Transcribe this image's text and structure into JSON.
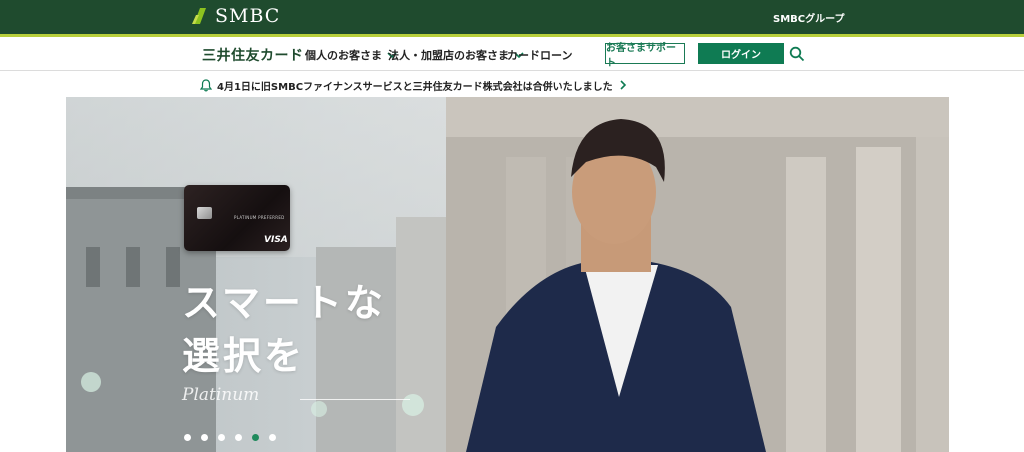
{
  "header": {
    "logo_text": "SMBC",
    "group_link": "SMBCグループ"
  },
  "nav": {
    "brand": "三井住友カード",
    "items": [
      {
        "label": "個人のお客さま",
        "has_dropdown": true
      },
      {
        "label": "法人・加盟店のお客さま",
        "has_dropdown": true
      },
      {
        "label": "カードローン",
        "has_dropdown": false
      }
    ],
    "support_button": "お客さまサポート",
    "login_button": "ログイン",
    "search_icon": "search-icon"
  },
  "notice": {
    "icon": "bell-icon",
    "text": "4月1日に旧SMBCファイナンスサービスと三井住友カード株式会社は合併いたしました"
  },
  "hero": {
    "card": {
      "label": "PLATINUM PREFERRED",
      "network": "VISA"
    },
    "headline_line1": "スマートな",
    "headline_line2": "選択を",
    "script_text": "Platinum",
    "slides": 6,
    "active_slide": 5
  },
  "colors": {
    "brand_dark_green": "#1f4b2e",
    "accent_lime": "#b8cf3c",
    "button_green": "#0f7b53"
  }
}
